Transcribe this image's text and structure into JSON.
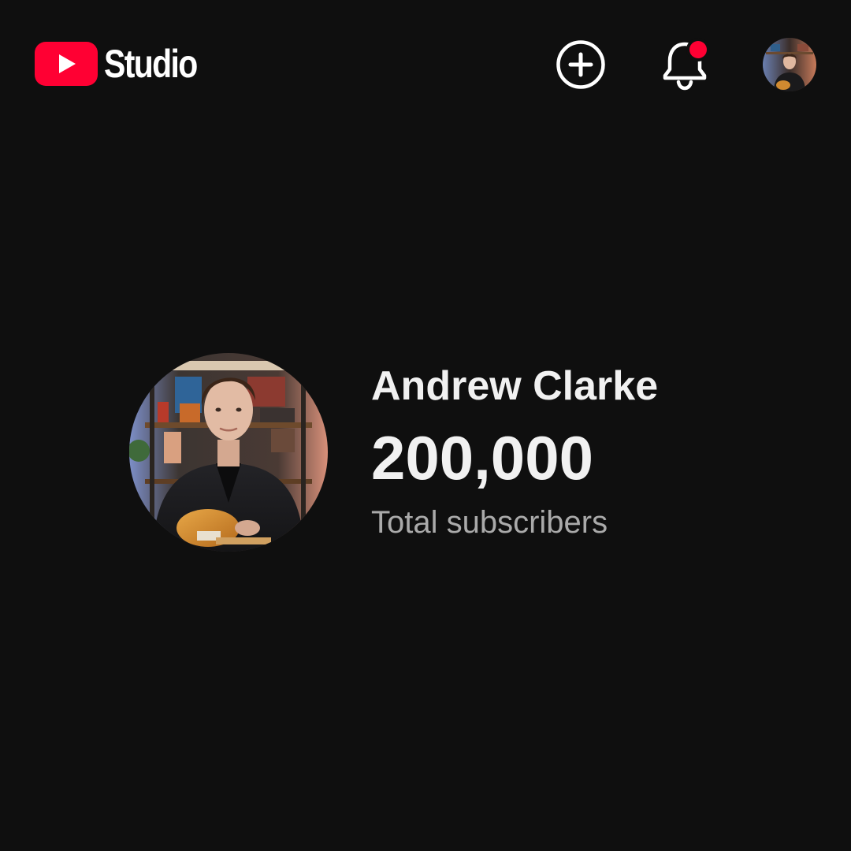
{
  "header": {
    "app_name": "Studio",
    "icons": {
      "logo": "youtube-play-icon",
      "create": "plus-circle-icon",
      "notifications": "bell-icon",
      "account": "account-avatar"
    },
    "notification_badge_color": "#ff0033"
  },
  "channel": {
    "name": "Andrew Clarke",
    "subscriber_count": "200,000",
    "subscriber_label": "Total subscribers"
  },
  "colors": {
    "background": "#0f0f0f",
    "brand_red": "#ff0033",
    "primary_text": "#f1f1f1",
    "secondary_text": "#aaaaaa"
  }
}
